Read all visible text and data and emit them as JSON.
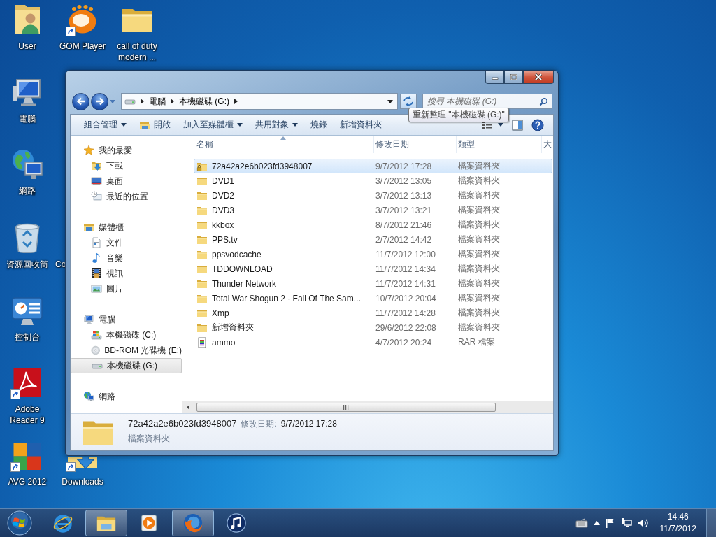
{
  "desktop_icons": [
    {
      "label": "User",
      "kind": "user-folder",
      "shortcut": false
    },
    {
      "label": "GOM Player",
      "kind": "media-player",
      "shortcut": true
    },
    {
      "label": "call of duty modern ...",
      "kind": "folder",
      "shortcut": false
    },
    {
      "label": "電腦",
      "kind": "computer",
      "shortcut": false
    },
    {
      "label": "網路",
      "kind": "network",
      "shortcut": false
    },
    {
      "label": "資源回收筒",
      "kind": "recycle-bin",
      "shortcut": false
    },
    {
      "label": "Co",
      "shortcut": false
    },
    {
      "label": "控制台",
      "kind": "control-panel",
      "shortcut": false
    },
    {
      "label": "Adobe Reader 9",
      "kind": "pdf-reader",
      "shortcut": true
    },
    {
      "label": "AVG 2012",
      "kind": "antivirus",
      "shortcut": true
    },
    {
      "label": "Downloads",
      "kind": "downloads",
      "shortcut": true
    }
  ],
  "window": {
    "breadcrumb": [
      "電腦",
      "本機磁碟 (G:)"
    ],
    "search": {
      "placeholder": "搜尋 本機磁碟 (G:)"
    },
    "tooltip": "重新整理 \"本機磁碟 (G:)\"",
    "toolbar": [
      {
        "label": "組合管理",
        "dropdown": true
      },
      {
        "label": "開啟",
        "kind": "open",
        "dropdown": false
      },
      {
        "label": "加入至媒體櫃",
        "dropdown": true
      },
      {
        "label": "共用對象",
        "dropdown": true
      },
      {
        "label": "燒錄",
        "dropdown": false
      },
      {
        "label": "新增資料夾",
        "dropdown": false
      }
    ],
    "sidebar": {
      "items": [
        {
          "label": "我的最愛",
          "kind": "star",
          "selected": false,
          "children": [
            {
              "label": "下載",
              "kind": "downloads",
              "selected": false
            },
            {
              "label": "桌面",
              "kind": "desktop",
              "selected": false
            },
            {
              "label": "最近的位置",
              "kind": "recent",
              "selected": false
            }
          ]
        },
        {
          "label": "媒體櫃",
          "kind": "library",
          "selected": false,
          "children": [
            {
              "label": "文件",
              "kind": "document",
              "selected": false
            },
            {
              "label": "音樂",
              "kind": "music",
              "selected": false
            },
            {
              "label": "視訊",
              "kind": "video",
              "selected": false
            },
            {
              "label": "圖片",
              "kind": "picture",
              "selected": false
            }
          ]
        },
        {
          "label": "電腦",
          "kind": "computer",
          "selected": false,
          "children": [
            {
              "label": "本機磁碟 (C:)",
              "kind": "drive-c",
              "selected": false
            },
            {
              "label": "BD-ROM 光碟機 (E:)",
              "kind": "optical-drive",
              "selected": false
            },
            {
              "label": "本機磁碟 (G:)",
              "kind": "drive",
              "selected": true
            }
          ]
        },
        {
          "label": "網路",
          "kind": "network",
          "selected": false
        }
      ]
    },
    "table": {
      "columns": [
        "名稱",
        "修改日期",
        "類型",
        "大"
      ],
      "rows": [
        {
          "name": "72a42a2e6b023fd3948007",
          "modified": "9/7/2012 17:28",
          "type": "檔案資料夾",
          "kind": "locked-folder",
          "selected": true
        },
        {
          "name": "DVD1",
          "modified": "3/7/2012 13:05",
          "type": "檔案資料夾",
          "kind": "folder",
          "selected": false
        },
        {
          "name": "DVD2",
          "modified": "3/7/2012 13:13",
          "type": "檔案資料夾",
          "kind": "folder",
          "selected": false
        },
        {
          "name": "DVD3",
          "modified": "3/7/2012 13:21",
          "type": "檔案資料夾",
          "kind": "folder",
          "selected": false
        },
        {
          "name": "kkbox",
          "modified": "8/7/2012 21:46",
          "type": "檔案資料夾",
          "kind": "folder",
          "selected": false
        },
        {
          "name": "PPS.tv",
          "modified": "2/7/2012 14:42",
          "type": "檔案資料夾",
          "kind": "folder",
          "selected": false
        },
        {
          "name": "ppsvodcache",
          "modified": "11/7/2012 12:00",
          "type": "檔案資料夾",
          "kind": "folder",
          "selected": false
        },
        {
          "name": "TDDOWNLOAD",
          "modified": "11/7/2012 14:34",
          "type": "檔案資料夾",
          "kind": "folder",
          "selected": false
        },
        {
          "name": "Thunder Network",
          "modified": "11/7/2012 14:31",
          "type": "檔案資料夾",
          "kind": "folder",
          "selected": false
        },
        {
          "name": "Total War Shogun 2 - Fall Of The Sam...",
          "modified": "10/7/2012 20:04",
          "type": "檔案資料夾",
          "kind": "folder",
          "selected": false
        },
        {
          "name": "Xmp",
          "modified": "11/7/2012 14:28",
          "type": "檔案資料夾",
          "kind": "folder",
          "selected": false
        },
        {
          "name": "新增資料夾",
          "modified": "29/6/2012 22:08",
          "type": "檔案資料夾",
          "kind": "folder",
          "selected": false
        },
        {
          "name": "ammo",
          "modified": "4/7/2012 20:24",
          "type": "RAR 檔案",
          "kind": "archive",
          "selected": false
        }
      ]
    },
    "details": {
      "name": "72a42a2e6b023fd3948007",
      "date_label": "修改日期:",
      "date": "9/7/2012 17:28",
      "type": "檔案資料夾"
    }
  },
  "taskbar": {
    "apps": [
      {
        "kind": "browser",
        "active": false
      },
      {
        "kind": "file-manager",
        "active": true
      },
      {
        "kind": "player",
        "active": false
      },
      {
        "kind": "firefox",
        "active": true
      },
      {
        "kind": "music-app",
        "active": false
      }
    ],
    "clock": {
      "time": "14:46",
      "date": "11/7/2012"
    }
  }
}
